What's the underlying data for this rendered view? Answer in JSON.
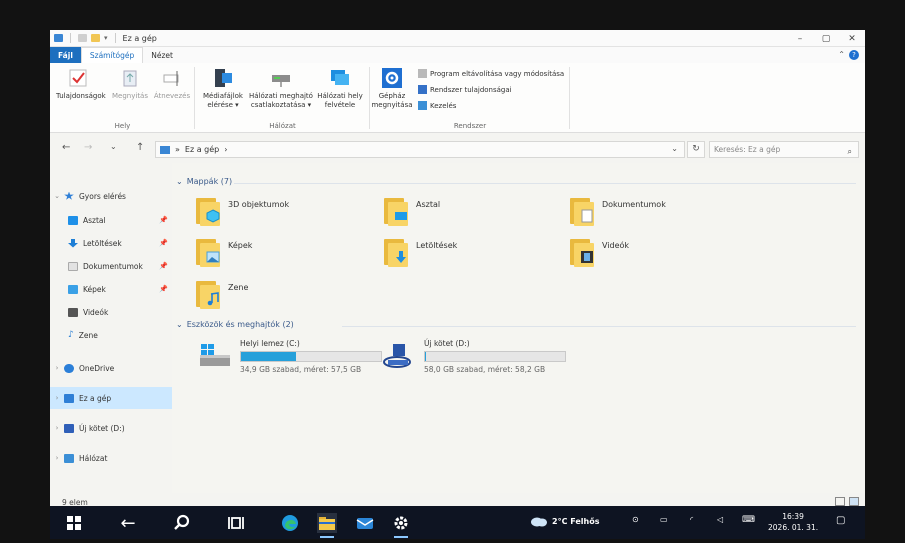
{
  "window": {
    "title": "Ez a gép",
    "controls": {
      "minimize": "–",
      "maximize": "▢",
      "close": "✕"
    }
  },
  "ribbon_tabs": [
    "Fájl",
    "Számítógép",
    "Nézet"
  ],
  "ribbon": {
    "hely": {
      "label": "Hely",
      "buttons": [
        "Tulajdonságok",
        "Megnyitás",
        "Átnevezés"
      ]
    },
    "halozat": {
      "label": "Hálózat",
      "buttons": [
        {
          "line1": "Médiafájlok",
          "line2": "elérése ▾"
        },
        {
          "line1": "Hálózati meghajtó",
          "line2": "csatlakoztatása ▾"
        },
        {
          "line1": "Hálózati hely",
          "line2": "felvétele"
        }
      ]
    },
    "rendszer": {
      "label": "Rendszer",
      "big_button": {
        "line1": "Gépház",
        "line2": "megnyitása"
      },
      "small_buttons": [
        "Program eltávolítása vagy módosítása",
        "Rendszer tulajdonságai",
        "Kezelés"
      ]
    }
  },
  "nav": {
    "back": "←",
    "forward": "→",
    "recent": "⌄",
    "up": "↑",
    "breadcrumb": [
      "»",
      "Ez a gép",
      "›"
    ],
    "search_placeholder": "Keresés: Ez a gép",
    "refresh": "↻",
    "dropdown": "⌄",
    "search_icon": "⌕"
  },
  "sidebar": {
    "quick_access": "Gyors elérés",
    "items": [
      {
        "label": "Asztal",
        "pinned": true
      },
      {
        "label": "Letöltések",
        "pinned": true
      },
      {
        "label": "Dokumentumok",
        "pinned": true
      },
      {
        "label": "Képek",
        "pinned": true
      },
      {
        "label": "Videók",
        "pinned": false
      },
      {
        "label": "Zene",
        "pinned": false
      }
    ],
    "onedrive": "OneDrive",
    "this_pc": "Ez a gép",
    "new_volume": "Új kötet (D:)",
    "network": "Hálózat"
  },
  "main": {
    "folders_header": "Mappák (7)",
    "folders": [
      "3D objektumok",
      "Asztal",
      "Dokumentumok",
      "Képek",
      "Letöltések",
      "Videók",
      "Zene"
    ],
    "devices_header": "Eszközök és meghajtók (2)",
    "drives": [
      {
        "name": "Helyi lemez (C:)",
        "free": "34,9 GB szabad, méret: 57,5 GB",
        "used_fraction": 0.39
      },
      {
        "name": "Új kötet (D:)",
        "free": "58,0 GB szabad, méret: 58,2 GB",
        "used_fraction": 0.003
      }
    ]
  },
  "status": {
    "count": "9 elem"
  },
  "taskbar": {
    "weather": "2°C Felhős",
    "time": "16:39",
    "date": "2026. 01. 31.",
    "accent": "#1d6fbf"
  }
}
